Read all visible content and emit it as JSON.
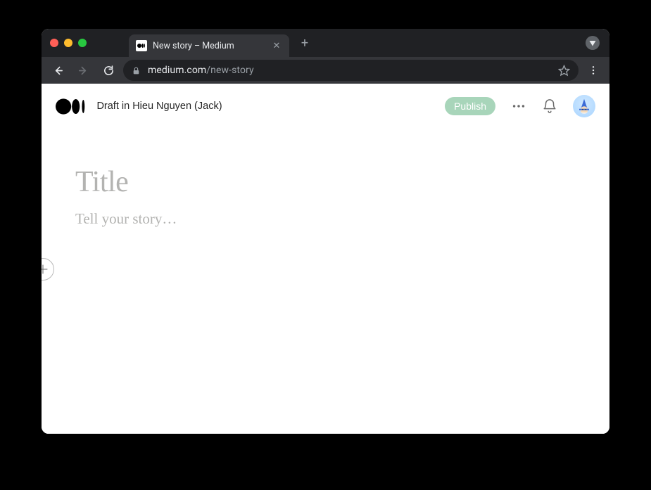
{
  "browser": {
    "tab": {
      "title": "New story – Medium"
    },
    "url": {
      "host": "medium.com",
      "path": "/new-story"
    }
  },
  "header": {
    "draft_label": "Draft in Hieu Nguyen (Jack)",
    "publish_label": "Publish"
  },
  "editor": {
    "title_placeholder": "Title",
    "body_placeholder": "Tell your story…"
  }
}
